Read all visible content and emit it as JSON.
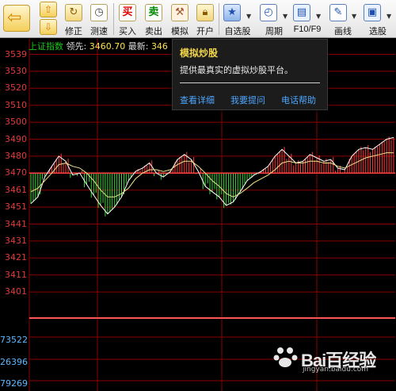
{
  "toolbar": {
    "buttons": [
      {
        "label": "修正"
      },
      {
        "label": "测速"
      },
      {
        "label": "买入"
      },
      {
        "label": "卖出"
      },
      {
        "label": "模拟"
      },
      {
        "label": "开户"
      },
      {
        "label": "自选股"
      },
      {
        "label": "周期"
      },
      {
        "label": "F10/F9"
      },
      {
        "label": "画线"
      },
      {
        "label": "选股"
      }
    ]
  },
  "header": {
    "index_name": "上证指数",
    "leader_label": "领先:",
    "leader_value": "3460.70",
    "latest_label": "最新:",
    "latest_value": "346"
  },
  "popup": {
    "title": "模拟炒股",
    "description": "提供最真实的虚拟炒股平台。",
    "links": [
      "查看详细",
      "我要提问",
      "电话帮助"
    ]
  },
  "chart_data": {
    "type": "line",
    "y_ticks": [
      "3539",
      "3530",
      "3520",
      "3510",
      "3500",
      "3490",
      "3480",
      "3470",
      "3461",
      "3451",
      "3441",
      "3431",
      "3421",
      "3411",
      "3401"
    ],
    "volume_ticks": [
      "73522",
      "26396",
      "79269"
    ],
    "base_price": 3470,
    "ylim": [
      3401,
      3539
    ],
    "series": [
      {
        "values": [
          3453,
          3457,
          3468,
          3474,
          3480,
          3477,
          3469,
          3470,
          3464,
          3458,
          3452,
          3447,
          3451,
          3457,
          3466,
          3471,
          3473,
          3476,
          3470,
          3468,
          3471,
          3478,
          3481,
          3478,
          3471,
          3463,
          3460,
          3457,
          3452,
          3454,
          3460,
          3466,
          3469,
          3471,
          3474,
          3480,
          3484,
          3480,
          3476,
          3477,
          3481,
          3479,
          3477,
          3478,
          3473,
          3472,
          3480,
          3484,
          3485,
          3484,
          3487,
          3490,
          3491
        ]
      },
      {
        "values": [
          3460,
          3462,
          3466,
          3470,
          3475,
          3476,
          3474,
          3473,
          3470,
          3466,
          3461,
          3457,
          3457,
          3459,
          3462,
          3467,
          3470,
          3472,
          3472,
          3471,
          3472,
          3475,
          3477,
          3477,
          3474,
          3470,
          3466,
          3463,
          3459,
          3457,
          3459,
          3462,
          3465,
          3467,
          3469,
          3472,
          3476,
          3477,
          3476,
          3476,
          3477,
          3477,
          3476,
          3476,
          3474,
          3473,
          3475,
          3477,
          3479,
          3480,
          3481,
          3482,
          3482
        ]
      }
    ]
  },
  "watermark": {
    "text": "Bai百经验",
    "url": "jingyan.baidu.com"
  },
  "colors": {
    "up": "#ff3b3b",
    "down": "#39d639",
    "grid": "#8b0000",
    "price_line": "#ffffff",
    "avg_line": "#f0e68c"
  }
}
